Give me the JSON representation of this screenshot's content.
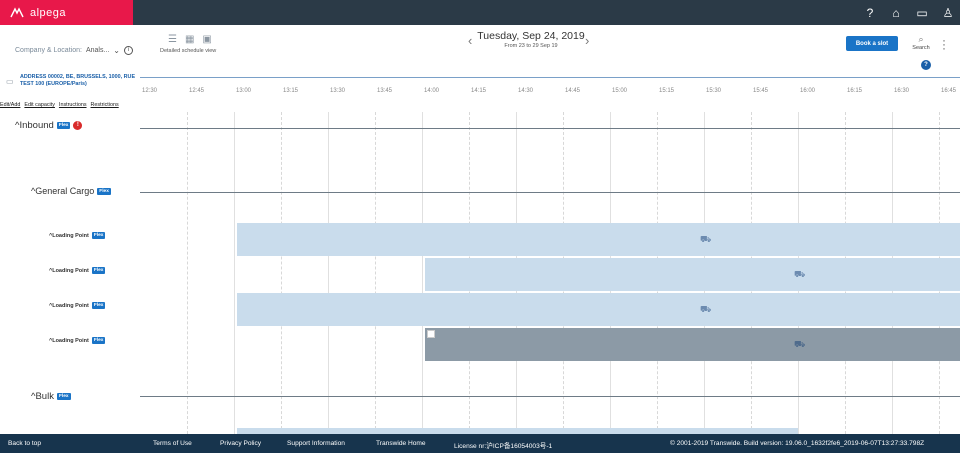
{
  "app": {
    "name": "alpega"
  },
  "topbar": {
    "icons": [
      "help-icon",
      "home-icon",
      "chat-icon",
      "user-icon"
    ],
    "help_glyph": "?",
    "home_glyph": "⌂",
    "chat_glyph": "▭",
    "user_glyph": "♙"
  },
  "header": {
    "company_label": "Company & Location:",
    "company_value": "Anals...",
    "view_label": "Detailed schedule view",
    "date": "Tuesday, Sep 24, 2019",
    "range": "From 23 to 29 Sep 19",
    "book_label": "Book a slot",
    "search_label": "Search",
    "help_label": "?"
  },
  "address": "ADDRESS 00002, BE, BRUSSELS, 1000, RUE TEST 100 (EUROPE/Paris)",
  "links": [
    "Edit/Add",
    "Edit capacity",
    "Instructions",
    "Restrictions"
  ],
  "ticks": [
    "12:30",
    "12:45",
    "13:00",
    "13:15",
    "13:30",
    "13:45",
    "14:00",
    "14:15",
    "14:30",
    "14:45",
    "15:00",
    "15:15",
    "15:30",
    "15:45",
    "16:00",
    "16:15",
    "16:30",
    "16:45"
  ],
  "rows": {
    "inbound": "^Inbound",
    "general_cargo": "^General Cargo",
    "lp1": "^Loading Point",
    "lp2": "^Loading Point",
    "lp3": "^Loading Point",
    "lp4": "^Loading Point",
    "bulk": "^Bulk",
    "flex": "Flex",
    "alert": "!"
  },
  "footer": {
    "back": "Back to top",
    "terms": "Terms of Use",
    "privacy": "Privacy Policy",
    "support": "Support Information",
    "home": "Transwide Home",
    "license": "License nr:沪ICP备16054003号-1",
    "copyright": "© 2001-2019 Transwide. Build version: 19.06.0_1632f2fe6_2019-06-07T13:27:33.798Z"
  },
  "colors": {
    "brand": "#e8184a",
    "topbar": "#2b3a47",
    "footer": "#17344d",
    "accent": "#1a74c7",
    "slot": "#c9dcec",
    "booked": "#8c9aa6"
  }
}
